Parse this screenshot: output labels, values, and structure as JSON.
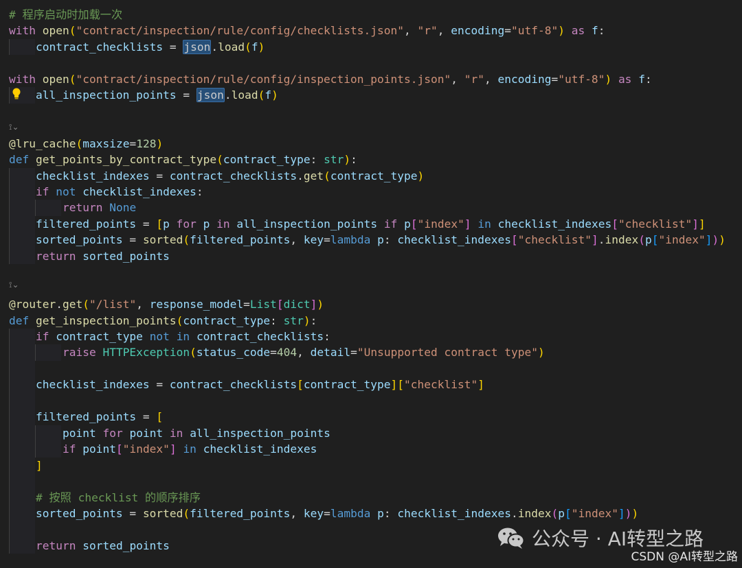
{
  "lines": [
    [
      [
        "cm",
        "# 程序启动时加载一次"
      ]
    ],
    [
      [
        "kw",
        "with"
      ],
      [
        "df",
        " "
      ],
      [
        "fn",
        "open"
      ],
      [
        "br1",
        "("
      ],
      [
        "st",
        "\"contract/inspection/rule/config/checklists.json\""
      ],
      [
        "df",
        ", "
      ],
      [
        "st",
        "\"r\""
      ],
      [
        "df",
        ", "
      ],
      [
        "vr",
        "encoding"
      ],
      [
        "df",
        "="
      ],
      [
        "st",
        "\"utf-8\""
      ],
      [
        "br1",
        ")"
      ],
      [
        "df",
        " "
      ],
      [
        "kw",
        "as"
      ],
      [
        "df",
        " "
      ],
      [
        "vr",
        "f"
      ],
      [
        "df",
        ":"
      ]
    ],
    [
      [
        "df",
        "    "
      ],
      [
        "vr",
        "contract_checklists"
      ],
      [
        "df",
        " = "
      ],
      [
        "hl",
        "json"
      ],
      [
        "df",
        "."
      ],
      [
        "fn",
        "load"
      ],
      [
        "br1",
        "("
      ],
      [
        "vr",
        "f"
      ],
      [
        "br1",
        ")"
      ]
    ],
    [],
    [
      [
        "kw",
        "with"
      ],
      [
        "df",
        " "
      ],
      [
        "fn",
        "open"
      ],
      [
        "br1",
        "("
      ],
      [
        "st",
        "\"contract/inspection/rule/config/inspection_points.json\""
      ],
      [
        "df",
        ", "
      ],
      [
        "st",
        "\"r\""
      ],
      [
        "df",
        ", "
      ],
      [
        "vr",
        "encoding"
      ],
      [
        "df",
        "="
      ],
      [
        "st",
        "\"utf-8\""
      ],
      [
        "br1",
        ")"
      ],
      [
        "df",
        " "
      ],
      [
        "kw",
        "as"
      ],
      [
        "df",
        " "
      ],
      [
        "vr",
        "f"
      ],
      [
        "df",
        ":"
      ]
    ],
    [
      [
        "df",
        "    "
      ],
      [
        "vr",
        "all_inspection_points"
      ],
      [
        "df",
        " = "
      ],
      [
        "hl",
        "json"
      ],
      [
        "df",
        "."
      ],
      [
        "fn",
        "load"
      ],
      [
        "br1",
        "("
      ],
      [
        "vr",
        "f"
      ],
      [
        "br1",
        ")"
      ]
    ],
    [],
    [],
    [
      [
        "fn",
        "@lru_cache"
      ],
      [
        "br1",
        "("
      ],
      [
        "vr",
        "maxsize"
      ],
      [
        "df",
        "="
      ],
      [
        "nm",
        "128"
      ],
      [
        "br1",
        ")"
      ]
    ],
    [
      [
        "kb",
        "def"
      ],
      [
        "df",
        " "
      ],
      [
        "fn",
        "get_points_by_contract_type"
      ],
      [
        "br1",
        "("
      ],
      [
        "vr",
        "contract_type"
      ],
      [
        "df",
        ": "
      ],
      [
        "tp",
        "str"
      ],
      [
        "br1",
        ")"
      ],
      [
        "df",
        ":"
      ]
    ],
    [
      [
        "df",
        "    "
      ],
      [
        "vr",
        "checklist_indexes"
      ],
      [
        "df",
        " = "
      ],
      [
        "vr",
        "contract_checklists"
      ],
      [
        "df",
        "."
      ],
      [
        "fn",
        "get"
      ],
      [
        "br1",
        "("
      ],
      [
        "vr",
        "contract_type"
      ],
      [
        "br1",
        ")"
      ]
    ],
    [
      [
        "df",
        "    "
      ],
      [
        "kw",
        "if"
      ],
      [
        "df",
        " "
      ],
      [
        "kb",
        "not"
      ],
      [
        "df",
        " "
      ],
      [
        "vr",
        "checklist_indexes"
      ],
      [
        "df",
        ":"
      ]
    ],
    [
      [
        "df",
        "        "
      ],
      [
        "kw",
        "return"
      ],
      [
        "df",
        " "
      ],
      [
        "kb",
        "None"
      ]
    ],
    [
      [
        "df",
        "    "
      ],
      [
        "vr",
        "filtered_points"
      ],
      [
        "df",
        " = "
      ],
      [
        "br1",
        "["
      ],
      [
        "vr",
        "p"
      ],
      [
        "df",
        " "
      ],
      [
        "kw",
        "for"
      ],
      [
        "df",
        " "
      ],
      [
        "vr",
        "p"
      ],
      [
        "df",
        " "
      ],
      [
        "kw",
        "in"
      ],
      [
        "df",
        " "
      ],
      [
        "vr",
        "all_inspection_points"
      ],
      [
        "df",
        " "
      ],
      [
        "kw",
        "if"
      ],
      [
        "df",
        " "
      ],
      [
        "vr",
        "p"
      ],
      [
        "br2",
        "["
      ],
      [
        "st",
        "\"index\""
      ],
      [
        "br2",
        "]"
      ],
      [
        "df",
        " "
      ],
      [
        "kb",
        "in"
      ],
      [
        "df",
        " "
      ],
      [
        "vr",
        "checklist_indexes"
      ],
      [
        "br2",
        "["
      ],
      [
        "st",
        "\"checklist\""
      ],
      [
        "br2",
        "]"
      ],
      [
        "br1",
        "]"
      ]
    ],
    [
      [
        "df",
        "    "
      ],
      [
        "vr",
        "sorted_points"
      ],
      [
        "df",
        " = "
      ],
      [
        "fn",
        "sorted"
      ],
      [
        "br1",
        "("
      ],
      [
        "vr",
        "filtered_points"
      ],
      [
        "df",
        ", "
      ],
      [
        "vr",
        "key"
      ],
      [
        "df",
        "="
      ],
      [
        "kb",
        "lambda"
      ],
      [
        "df",
        " "
      ],
      [
        "vr",
        "p"
      ],
      [
        "df",
        ": "
      ],
      [
        "vr",
        "checklist_indexes"
      ],
      [
        "br2",
        "["
      ],
      [
        "st",
        "\"checklist\""
      ],
      [
        "br2",
        "]"
      ],
      [
        "df",
        "."
      ],
      [
        "fn",
        "index"
      ],
      [
        "br2",
        "("
      ],
      [
        "vr",
        "p"
      ],
      [
        "br3",
        "["
      ],
      [
        "st",
        "\"index\""
      ],
      [
        "br3",
        "]"
      ],
      [
        "br2",
        ")"
      ],
      [
        "br1",
        ")"
      ]
    ],
    [
      [
        "df",
        "    "
      ],
      [
        "kw",
        "return"
      ],
      [
        "df",
        " "
      ],
      [
        "vr",
        "sorted_points"
      ]
    ],
    [],
    [],
    [
      [
        "fn",
        "@router"
      ],
      [
        "df",
        "."
      ],
      [
        "fn",
        "get"
      ],
      [
        "br1",
        "("
      ],
      [
        "st",
        "\"/list\""
      ],
      [
        "df",
        ", "
      ],
      [
        "vr",
        "response_model"
      ],
      [
        "df",
        "="
      ],
      [
        "tp",
        "List"
      ],
      [
        "br2",
        "["
      ],
      [
        "tp",
        "dict"
      ],
      [
        "br2",
        "]"
      ],
      [
        "br1",
        ")"
      ]
    ],
    [
      [
        "kb",
        "def"
      ],
      [
        "df",
        " "
      ],
      [
        "fn",
        "get_inspection_points"
      ],
      [
        "br1",
        "("
      ],
      [
        "vr",
        "contract_type"
      ],
      [
        "df",
        ": "
      ],
      [
        "tp",
        "str"
      ],
      [
        "br1",
        ")"
      ],
      [
        "df",
        ":"
      ]
    ],
    [
      [
        "df",
        "    "
      ],
      [
        "kw",
        "if"
      ],
      [
        "df",
        " "
      ],
      [
        "vr",
        "contract_type"
      ],
      [
        "df",
        " "
      ],
      [
        "kb",
        "not"
      ],
      [
        "df",
        " "
      ],
      [
        "kb",
        "in"
      ],
      [
        "df",
        " "
      ],
      [
        "vr",
        "contract_checklists"
      ],
      [
        "df",
        ":"
      ]
    ],
    [
      [
        "df",
        "        "
      ],
      [
        "kw",
        "raise"
      ],
      [
        "df",
        " "
      ],
      [
        "tp",
        "HTTPException"
      ],
      [
        "br1",
        "("
      ],
      [
        "vr",
        "status_code"
      ],
      [
        "df",
        "="
      ],
      [
        "nm",
        "404"
      ],
      [
        "df",
        ", "
      ],
      [
        "vr",
        "detail"
      ],
      [
        "df",
        "="
      ],
      [
        "st",
        "\"Unsupported contract type\""
      ],
      [
        "br1",
        ")"
      ]
    ],
    [],
    [
      [
        "df",
        "    "
      ],
      [
        "vr",
        "checklist_indexes"
      ],
      [
        "df",
        " = "
      ],
      [
        "vr",
        "contract_checklists"
      ],
      [
        "br1",
        "["
      ],
      [
        "vr",
        "contract_type"
      ],
      [
        "br1",
        "]"
      ],
      [
        "br1",
        "["
      ],
      [
        "st",
        "\"checklist\""
      ],
      [
        "br1",
        "]"
      ]
    ],
    [],
    [
      [
        "df",
        "    "
      ],
      [
        "vr",
        "filtered_points"
      ],
      [
        "df",
        " = "
      ],
      [
        "br1",
        "["
      ]
    ],
    [
      [
        "df",
        "        "
      ],
      [
        "vr",
        "point"
      ],
      [
        "df",
        " "
      ],
      [
        "kw",
        "for"
      ],
      [
        "df",
        " "
      ],
      [
        "vr",
        "point"
      ],
      [
        "df",
        " "
      ],
      [
        "kw",
        "in"
      ],
      [
        "df",
        " "
      ],
      [
        "vr",
        "all_inspection_points"
      ]
    ],
    [
      [
        "df",
        "        "
      ],
      [
        "kw",
        "if"
      ],
      [
        "df",
        " "
      ],
      [
        "vr",
        "point"
      ],
      [
        "br2",
        "["
      ],
      [
        "st",
        "\"index\""
      ],
      [
        "br2",
        "]"
      ],
      [
        "df",
        " "
      ],
      [
        "kb",
        "in"
      ],
      [
        "df",
        " "
      ],
      [
        "vr",
        "checklist_indexes"
      ]
    ],
    [
      [
        "df",
        "    "
      ],
      [
        "br1",
        "]"
      ]
    ],
    [],
    [
      [
        "df",
        "    "
      ],
      [
        "cm",
        "# 按照 checklist 的顺序排序"
      ]
    ],
    [
      [
        "df",
        "    "
      ],
      [
        "vr",
        "sorted_points"
      ],
      [
        "df",
        " = "
      ],
      [
        "fn",
        "sorted"
      ],
      [
        "br1",
        "("
      ],
      [
        "vr",
        "filtered_points"
      ],
      [
        "df",
        ", "
      ],
      [
        "vr",
        "key"
      ],
      [
        "df",
        "="
      ],
      [
        "kb",
        "lambda"
      ],
      [
        "df",
        " "
      ],
      [
        "vr",
        "p"
      ],
      [
        "df",
        ": "
      ],
      [
        "vr",
        "checklist_indexes"
      ],
      [
        "df",
        "."
      ],
      [
        "fn",
        "index"
      ],
      [
        "br2",
        "("
      ],
      [
        "vr",
        "p"
      ],
      [
        "br3",
        "["
      ],
      [
        "st",
        "\"index\""
      ],
      [
        "br3",
        "]"
      ],
      [
        "br2",
        ")"
      ],
      [
        "br1",
        ")"
      ]
    ],
    [],
    [
      [
        "df",
        "    "
      ],
      [
        "kw",
        "return"
      ],
      [
        "df",
        " "
      ],
      [
        "vr",
        "sorted_points"
      ]
    ]
  ],
  "fold_marker": "⟟⌄",
  "watermark": {
    "account": "公众号 · AI转型之路",
    "csdn": "CSDN @AI转型之路"
  }
}
